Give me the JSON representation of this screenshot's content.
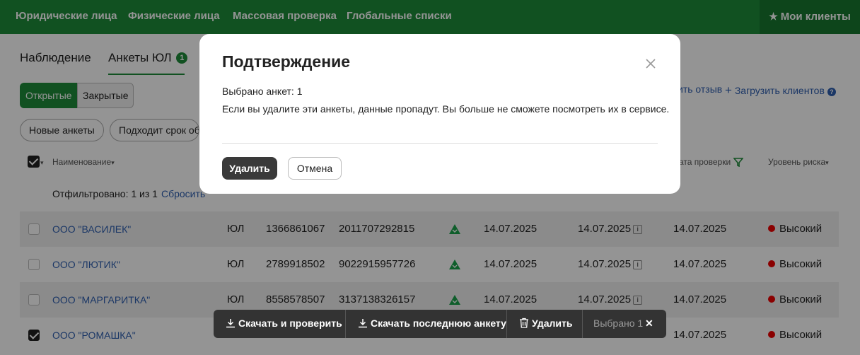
{
  "topnav": {
    "items": [
      "Юридические лица",
      "Физические лица",
      "Массовая проверка",
      "Глобальные списки"
    ],
    "my_clients": "Мои клиенты",
    "my_clients_icon": "star-icon"
  },
  "tabs": [
    {
      "label": "Наблюдение"
    },
    {
      "label": "Анкеты ЮЛ",
      "badge": "1"
    }
  ],
  "status_filter": {
    "open": "Открытые",
    "closed": "Закрытые"
  },
  "chips": [
    "Новые анкеты",
    "Подходит срок об"
  ],
  "right_actions": {
    "feedback": "ить отзыв",
    "upload": "Загрузить клиентов"
  },
  "table": {
    "headers": {
      "name": "Наименование",
      "check_date": "ата проверки",
      "risk": "Уровень риска"
    },
    "filtered_text": "Отфильтровано: 1 из 1",
    "reset": "Сбросить",
    "rows": [
      {
        "name": "ООО \"ВАСИЛЕК\"",
        "type": "ЮЛ",
        "inn": "1366861067",
        "ogrn": "2011707292815",
        "date1": "14.07.2025",
        "date2": "14.07.2025",
        "date3": "14.07.2025",
        "risk": "Высокий",
        "checked": false
      },
      {
        "name": "ООО \"ЛЮТИК\"",
        "type": "ЮЛ",
        "inn": "2789918502",
        "ogrn": "9022915957726",
        "date1": "14.07.2025",
        "date2": "14.07.2025",
        "date3": "14.07.2025",
        "risk": "Высокий",
        "checked": false
      },
      {
        "name": "ООО \"МАРГАРИТКА\"",
        "type": "ЮЛ",
        "inn": "8558578507",
        "ogrn": "3137138326157",
        "date1": "14.07.2025",
        "date2": "14.07.2025",
        "date3": "14.07.2025",
        "risk": "Высокий",
        "checked": false
      },
      {
        "name": "ООО \"РОМАШКА\"",
        "type": "",
        "inn": "",
        "ogrn": "",
        "date1": "",
        "date2": "",
        "date3": "14.07.2025",
        "risk": "Высокий",
        "checked": true
      }
    ],
    "risk_color": "#e00000"
  },
  "dialog": {
    "title": "Подтверждение",
    "selected": "Выбрано анкет: 1",
    "warning": "Если вы удалите эти анкеты, данные пропадут. Вы больше не сможете посмотреть их в сервисе.",
    "delete": "Удалить",
    "cancel": "Отмена"
  },
  "action_bar": {
    "download_check": "Скачать и проверить",
    "download_last": "Скачать последнюю анкету",
    "delete": "Удалить",
    "selected": "Выбрано 1"
  },
  "colors": {
    "brand": "#1e8c3a",
    "link": "#2f5fb0"
  }
}
